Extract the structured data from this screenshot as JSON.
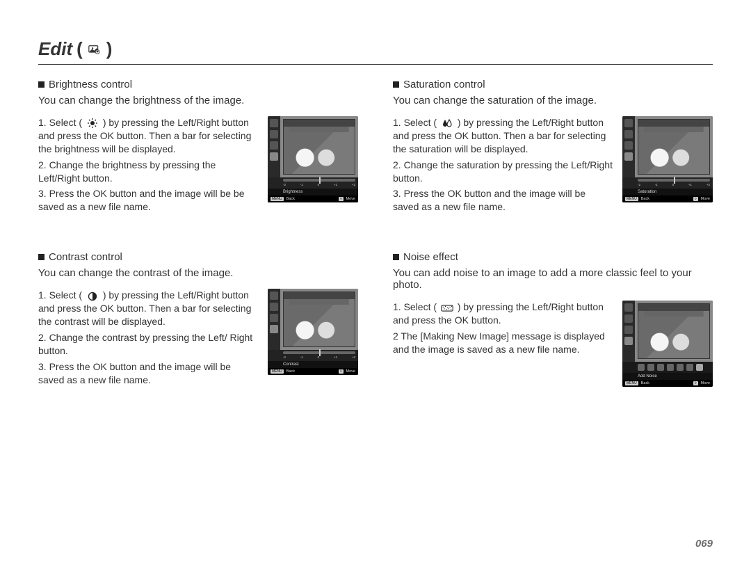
{
  "page_title": "Edit",
  "page_number": "069",
  "slider_ticks": [
    "-2",
    "-1",
    "0",
    "+1",
    "+2"
  ],
  "screen_footer": {
    "back_tag": "MENU",
    "back_label": "Back",
    "move_tag": "◊",
    "move_label": "Move"
  },
  "sections": {
    "brightness": {
      "title": "Brightness control",
      "intro": "You can change the brightness of the image.",
      "step1_pre": "1. Select (",
      "step1_post": ") by pressing the Left/Right button and press the OK button. Then a bar for selecting the brightness will be displayed.",
      "step2": "2. Change the brightness by pressing the Left/Right button.",
      "step3": "3. Press the OK button and the image will be be saved as a new file name.",
      "screen_label": "Brightness"
    },
    "contrast": {
      "title": "Contrast control",
      "intro": "You can change the contrast of the image.",
      "step1_pre": "1. Select (",
      "step1_post": ") by pressing the Left/Right button and press the OK button. Then a bar for selecting the contrast will be displayed.",
      "step2": "2. Change the contrast by pressing the Left/ Right button.",
      "step3": "3. Press the OK button and the image will be saved as a new file name.",
      "screen_label": "Contrast"
    },
    "saturation": {
      "title": "Saturation control",
      "intro": "You can change the saturation of the image.",
      "step1_pre": "1. Select (",
      "step1_post": ") by pressing the Left/Right button and press the OK button. Then a bar for selecting the saturation will be displayed.",
      "step2": "2. Change the saturation by pressing the Left/Right button.",
      "step3": "3. Press the OK button and the image will be saved as a new file name.",
      "screen_label": "Saturation"
    },
    "noise": {
      "title": "Noise effect",
      "intro": "You can add noise to an image to add a more classic feel to your photo.",
      "step1_pre": "1. Select (",
      "step1_post": ") by pressing the Left/Right button and press the OK button.",
      "step2": "2 The [Making New Image] message is displayed and the image is saved as a new file name.",
      "screen_label": "Add Noise"
    }
  }
}
